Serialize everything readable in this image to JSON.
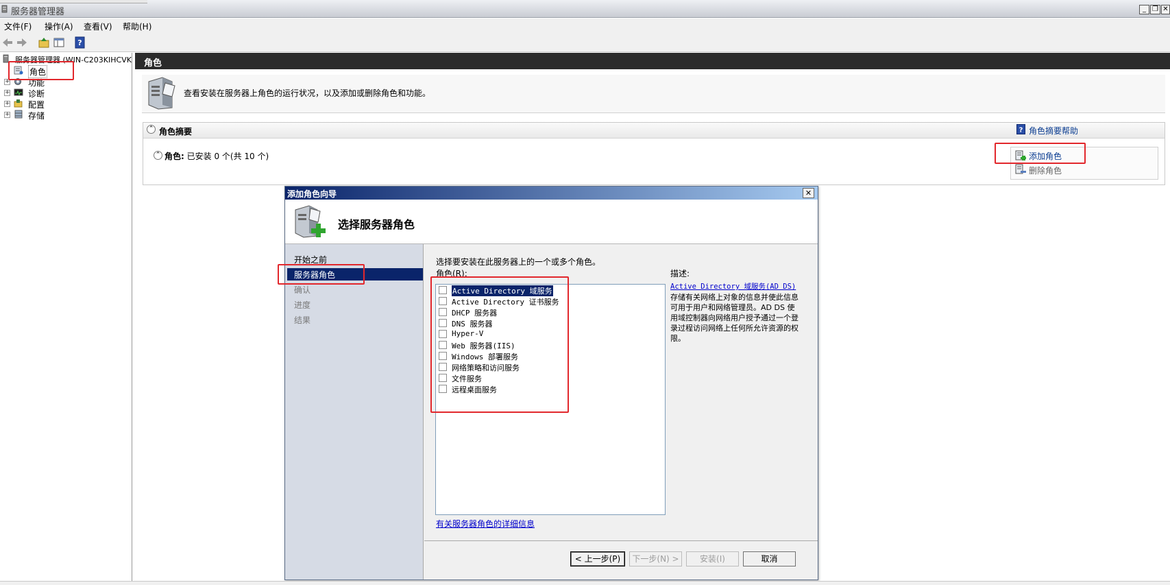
{
  "window": {
    "title": "服务器管理器",
    "minimize": "_",
    "restore": "❐",
    "close": "✕"
  },
  "menu": {
    "items": [
      "文件(F)",
      "操作(A)",
      "查看(V)",
      "帮助(H)"
    ]
  },
  "tree": {
    "root": "服务器管理器 (WIN-C203KIHCVK",
    "items": [
      {
        "label": "角色",
        "icon": "roles-icon"
      },
      {
        "label": "功能",
        "icon": "features-icon"
      },
      {
        "label": "诊断",
        "icon": "diagnostics-icon"
      },
      {
        "label": "配置",
        "icon": "configuration-icon"
      },
      {
        "label": "存储",
        "icon": "storage-icon"
      }
    ]
  },
  "pane": {
    "header": "角色",
    "info": "查看安装在服务器上角色的运行状况，以及添加或删除角色和功能。",
    "summary_title": "角色摘要",
    "help_link": "角色摘要帮助",
    "roles_line_label": "角色:",
    "roles_line_value": "已安装 0 个(共 10 个)",
    "add_role": "添加角色",
    "remove_role": "删除角色"
  },
  "dialog": {
    "title": "添加角色向导",
    "close": "✕",
    "heading": "选择服务器角色",
    "nav": [
      "开始之前",
      "服务器角色",
      "确认",
      "进度",
      "结果"
    ],
    "nav_selected_index": 1,
    "instruction": "选择要安装在此服务器上的一个或多个角色。",
    "roles_label": "角色(R):",
    "desc_label": "描述:",
    "roles": [
      "Active Directory 域服务",
      "Active Directory 证书服务",
      "DHCP 服务器",
      "DNS 服务器",
      "Hyper-V",
      "Web 服务器(IIS)",
      "Windows 部署服务",
      "网络策略和访问服务",
      "文件服务",
      "远程桌面服务"
    ],
    "desc_link": "Active Directory 域服务(AD DS)",
    "desc_body": "存储有关网络上对象的信息并使此信息可用于用户和网络管理员。AD DS 使用域控制器向网络用户授予通过一个登录过程访问网络上任何所允许资源的权限。",
    "more_info": "有关服务器角色的详细信息",
    "buttons": {
      "back": "< 上一步(P)",
      "next": "下一步(N) >",
      "install": "安装(I)",
      "cancel": "取消"
    }
  },
  "colors": {
    "annotation_red": "#e2272c",
    "dialog_title_blue": "#0a246a",
    "link_blue": "#0000cc"
  }
}
